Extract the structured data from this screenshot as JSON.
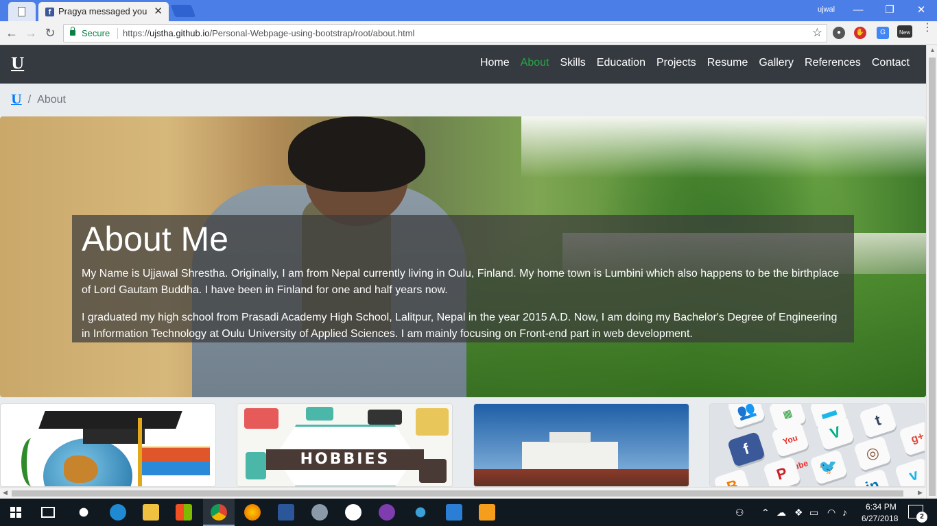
{
  "browser": {
    "tab_title": "Pragya messaged you",
    "window_user": "ujwal",
    "secure_label": "Secure",
    "url_scheme": "https://",
    "url_host": "ujstha.github.io",
    "url_path": "/Personal-Webpage-using-bootstrap/root/about.html",
    "extension_new_label": "New"
  },
  "site": {
    "brand": "U",
    "nav": [
      "Home",
      "About",
      "Skills",
      "Education",
      "Projects",
      "Resume",
      "Gallery",
      "References",
      "Contact"
    ],
    "active_nav": "About",
    "breadcrumb": {
      "home": "U",
      "current": "About"
    },
    "about": {
      "heading": "About Me",
      "paragraph_1": "My Name is Ujjawal Shrestha. Originally, I am from Nepal currently living in Oulu, Finland. My home town is Lumbini which also happens to be the birthplace of Lord Gautam Buddha. I have been in Finland for one and half years now.",
      "paragraph_2": "I graduated my high school from Prasadi Academy High School, Lalitpur, Nepal in the year 2015 A.D. Now, I am doing my Bachelor's Degree of Engineering in Information Technology at Oulu University of Applied Sciences. I am mainly focusing on Front-end part in web development."
    },
    "cards": {
      "hobbies_banner": "HOBBIES"
    }
  },
  "taskbar": {
    "time": "6:34 PM",
    "date": "6/27/2018",
    "notification_count": "2"
  },
  "colors": {
    "navbar": "#343a40",
    "active_link": "#28a745",
    "breadcrumb_link": "#007bff",
    "chrome_tabstrip": "#4b7ee6"
  }
}
